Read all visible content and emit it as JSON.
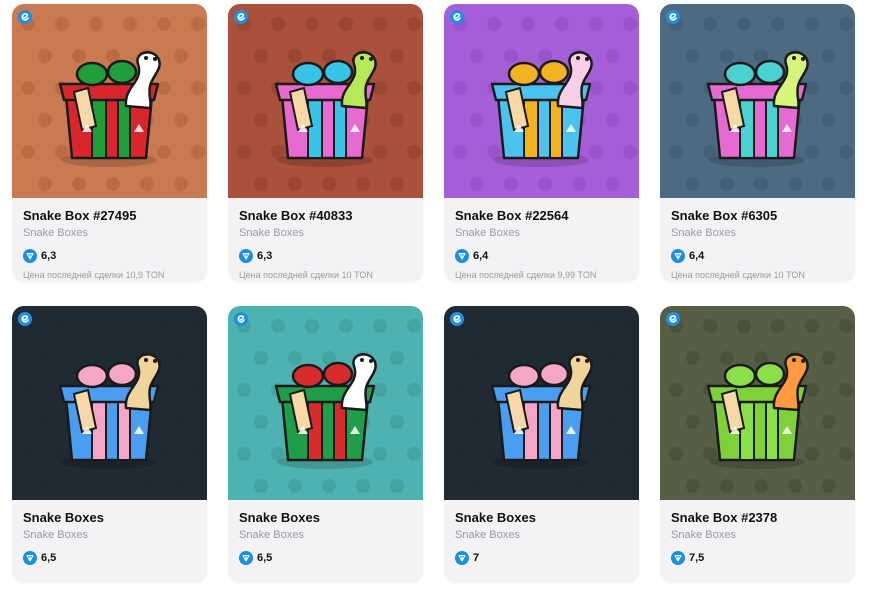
{
  "colors": {
    "card_bg": "#f3f3f5",
    "ton_blue": "#1a8fe3",
    "title": "#111111",
    "muted": "#9a9aa2"
  },
  "cards": [
    {
      "title": "Snake Box #27495",
      "collection": "Snake Boxes",
      "price": "6,3",
      "last_sale": "Цена последней сделки 10,9 TON",
      "bg": "#c97a52",
      "pattern": "#b5663f",
      "box": "#d8262c",
      "ribbon": "#1f9e3a",
      "snake": "#ffffff"
    },
    {
      "title": "Snake Box #40833",
      "collection": "Snake Boxes",
      "price": "6,3",
      "last_sale": "Цена последней сделки 10 TON",
      "bg": "#a9513a",
      "pattern": "#93432e",
      "box": "#e76ad0",
      "ribbon": "#37c4e6",
      "snake": "#b8e85a"
    },
    {
      "title": "Snake Box #22564",
      "collection": "Snake Boxes",
      "price": "6,4",
      "last_sale": "Цена последней сделки 9,99 TON",
      "bg": "#a55fd6",
      "pattern": "#9450c6",
      "box": "#4cc3ee",
      "ribbon": "#f3b21f",
      "snake": "#f7d0e8"
    },
    {
      "title": "Snake Box #6305",
      "collection": "Snake Boxes",
      "price": "6,4",
      "last_sale": "Цена последней сделки 10 TON",
      "bg": "#4c6a82",
      "pattern": "#3f5c72",
      "box": "#e56ad2",
      "ribbon": "#49d2cf",
      "snake": "#d6f57a"
    },
    {
      "title": "Snake Boxes",
      "collection": "Snake Boxes",
      "price": "6,5",
      "last_sale": "",
      "bg": "#1f2a33",
      "pattern": "#1f2a33",
      "box": "#4a9df0",
      "ribbon": "#f4a6c6",
      "snake": "#f1d49b"
    },
    {
      "title": "Snake Boxes",
      "collection": "Snake Boxes",
      "price": "6,5",
      "last_sale": "",
      "bg": "#4eb2b0",
      "pattern": "#3f9e9c",
      "box": "#1f9e4a",
      "ribbon": "#d72c2c",
      "snake": "#ffffff"
    },
    {
      "title": "Snake Boxes",
      "collection": "Snake Boxes",
      "price": "7",
      "last_sale": "",
      "bg": "#1f2a33",
      "pattern": "#1f2a33",
      "box": "#4a9df0",
      "ribbon": "#f4a6c6",
      "snake": "#f1d49b"
    },
    {
      "title": "Snake Box #2378",
      "collection": "Snake Boxes",
      "price": "7,5",
      "last_sale": "",
      "bg": "#565e45",
      "pattern": "#474f37",
      "box": "#7fd13a",
      "ribbon": "#8be04a",
      "snake": "#ff9a40"
    }
  ]
}
